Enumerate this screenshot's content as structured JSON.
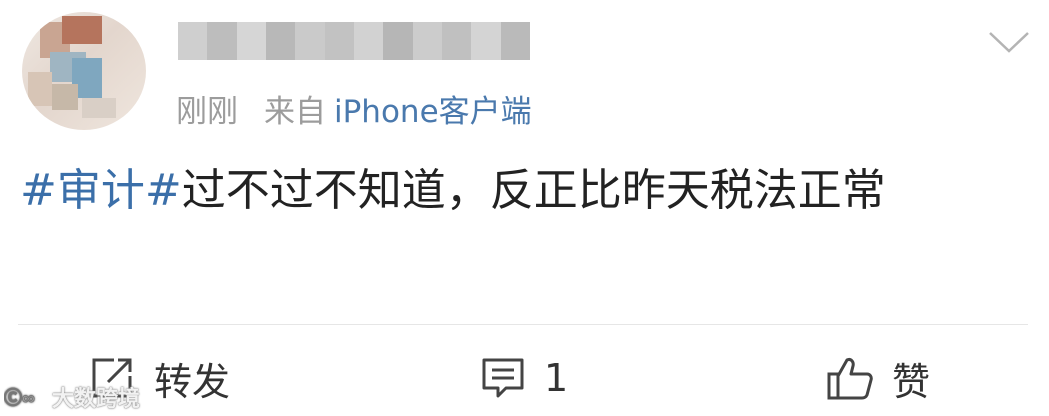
{
  "post": {
    "time": "刚刚",
    "source_prefix": "来自",
    "device": "iPhone客户端",
    "hashtag": "#审计#",
    "body": "过不过不知道，反正比昨天税法正常"
  },
  "actions": {
    "repost_label": "转发",
    "comment_count": "1",
    "like_label": "赞"
  },
  "watermark": {
    "text": "大数跨境"
  },
  "icons": {
    "avatar": "avatar-blurred",
    "menu": "chevron-down-icon",
    "repost": "repost-icon",
    "comment": "comment-icon",
    "like": "thumbs-up-icon",
    "watermark_logo": "brand-logo-icon"
  },
  "colors": {
    "link": "#3b6fa9",
    "meta_text": "#9c9c9c",
    "body_text": "#222222"
  }
}
